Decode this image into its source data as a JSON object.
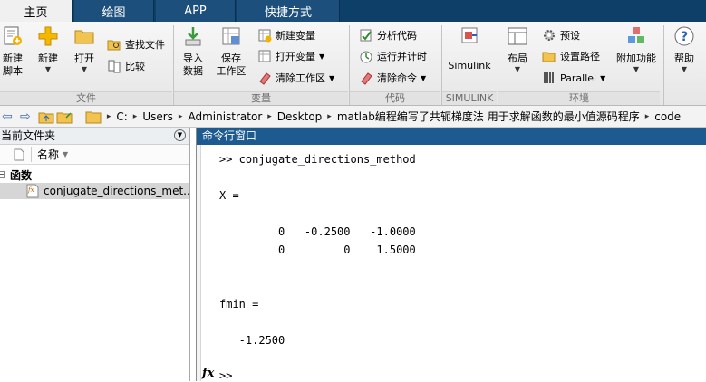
{
  "tabs": [
    {
      "label": "主页"
    },
    {
      "label": "绘图"
    },
    {
      "label": "APP"
    },
    {
      "label": "快捷方式"
    }
  ],
  "ribbon": {
    "file_group": {
      "label": "文件",
      "new_script": "新建\n脚本",
      "new": "新建",
      "open": "打开",
      "find_files": "查找文件",
      "compare": "比较"
    },
    "variable_group": {
      "label": "变量",
      "import_data": "导入\n数据",
      "save_workspace": "保存\n工作区",
      "new_variable": "新建变量",
      "open_variable": "打开变量",
      "clear_workspace": "清除工作区"
    },
    "code_group": {
      "label": "代码",
      "analyze_code": "分析代码",
      "run_and_time": "运行并计时",
      "clear_commands": "清除命令"
    },
    "simulink_group": {
      "label": "SIMULINK",
      "simulink": "Simulink"
    },
    "environment_group": {
      "label": "环境",
      "layout": "布局",
      "preferences": "预设",
      "set_path": "设置路径",
      "parallel": "Parallel",
      "addons": "附加功能",
      "help": "帮助"
    }
  },
  "address": {
    "crumbs": [
      "C:",
      "Users",
      "Administrator",
      "Desktop",
      "matlab编程编写了共轭梯度法 用于求解函数的最小值源码程序",
      "code"
    ]
  },
  "current_folder": {
    "title": "当前文件夹",
    "column_name": "名称",
    "group_label": "函数",
    "file": "conjugate_directions_met..."
  },
  "command_window": {
    "title": "命令行窗口",
    "prompt_cmd": ">> conjugate_directions_method",
    "x_label": "X =",
    "x_row1": "         0   -0.2500   -1.0000",
    "x_row2": "         0         0    1.5000",
    "fmin_label": "fmin =",
    "fmin_value": "   -1.2500",
    "fx_label": "fx",
    "final_prompt": ">>"
  },
  "colors": {
    "tab_bar": "#0e3f68",
    "command_title": "#1c5a8f"
  }
}
